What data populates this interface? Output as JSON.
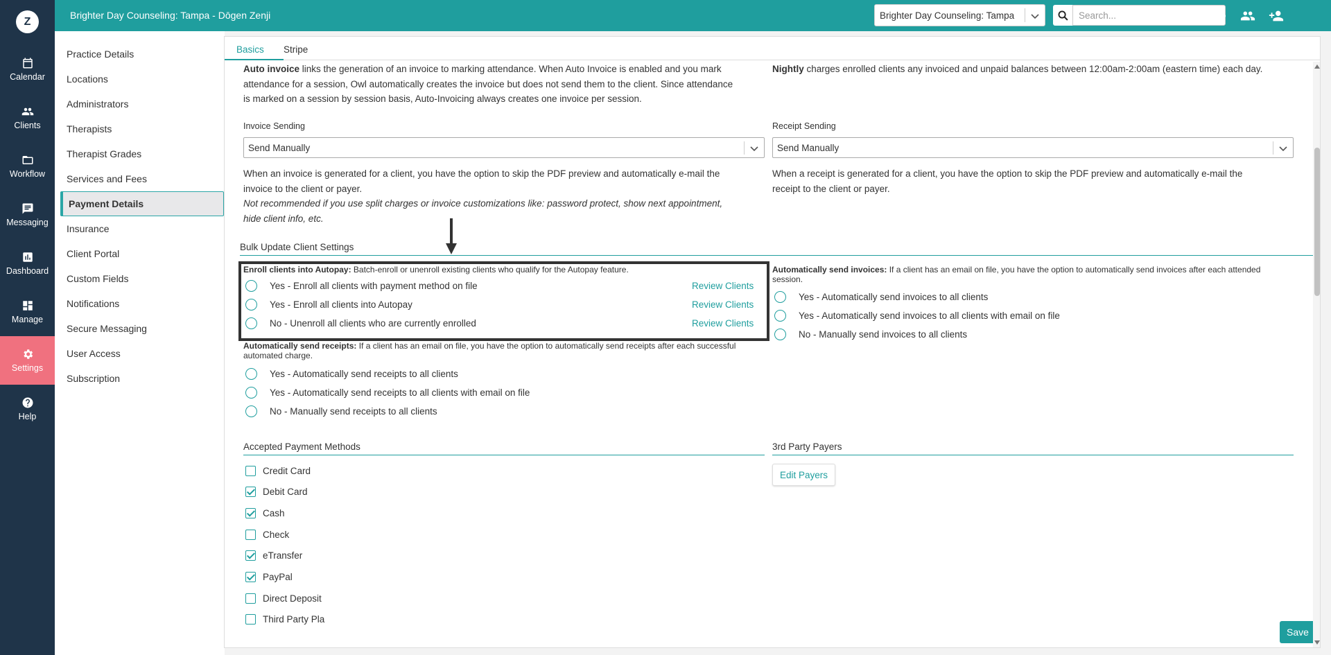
{
  "app": {
    "logo_letter": "Z",
    "header_title": "Brighter Day Counseling: Tampa - Dōgen Zenji",
    "practice_select_value": "Brighter Day Counseling: Tampa",
    "search_placeholder": "Search..."
  },
  "leftnav": {
    "items": [
      {
        "label": "Calendar",
        "icon": "calendar-icon"
      },
      {
        "label": "Clients",
        "icon": "people-icon"
      },
      {
        "label": "Workflow",
        "icon": "folder-icon"
      },
      {
        "label": "Messaging",
        "icon": "message-icon"
      },
      {
        "label": "Dashboard",
        "icon": "chart-icon"
      },
      {
        "label": "Manage",
        "icon": "grid-icon"
      },
      {
        "label": "Settings",
        "icon": "gear-icon"
      },
      {
        "label": "Help",
        "icon": "help-icon"
      }
    ]
  },
  "sidebar": {
    "items": [
      "Practice Details",
      "Locations",
      "Administrators",
      "Therapists",
      "Therapist Grades",
      "Services and Fees",
      "Payment Details",
      "Insurance",
      "Client Portal",
      "Custom Fields",
      "Notifications",
      "Secure Messaging",
      "User Access",
      "Subscription"
    ],
    "active": "Payment Details"
  },
  "tabs": [
    "Basics",
    "Stripe"
  ],
  "auto_invoice": {
    "bold": "Auto invoice",
    "line1": " links the generation of an invoice to marking attendance. When Auto Invoice is enabled and you mark",
    "line2": "attendance for a session, Owl automatically creates the invoice but does not send them to the client. Since attendance",
    "line3": "is marked on a session by session basis, Auto-Invoicing always creates one invoice per session."
  },
  "nightly": {
    "bold": "Nightly",
    "text": " charges enrolled clients any invoiced and unpaid balances between 12:00am-2:00am (eastern time) each day."
  },
  "invoice_sending": {
    "label": "Invoice Sending",
    "value": "Send Manually",
    "desc1": "When an invoice is generated for a client, you have the option to skip the PDF preview and automatically e-mail the",
    "desc2": "invoice to the client or payer.",
    "note1": "Not recommended if you use split charges or invoice customizations like: password protect, show next appointment,",
    "note2": "hide client info, etc."
  },
  "receipt_sending": {
    "label": "Receipt Sending",
    "value": "Send Manually",
    "desc1": "When a receipt is generated for a client, you have the option to skip the PDF preview and automatically e-mail the",
    "desc2": "receipt to the client or payer."
  },
  "bulk": {
    "heading": "Bulk Update Client Settings",
    "autopay_bold": "Enroll clients into Autopay:",
    "autopay_text": " Batch-enroll or unenroll existing clients who qualify for the Autopay feature.",
    "autopay_options": [
      "Yes - Enroll all clients with payment method on file",
      "Yes - Enroll all clients into Autopay",
      "No - Unenroll all clients who are currently enrolled"
    ],
    "review_label": "Review Clients",
    "receipts_bold": "Automatically send receipts:",
    "receipts_text1": " If a client has an email on file, you have the option to automatically send receipts after each successful",
    "receipts_text2": "automated charge.",
    "receipts_options": [
      "Yes - Automatically send receipts to all clients",
      "Yes - Automatically send receipts to all clients with email on file",
      "No - Manually send receipts to all clients"
    ],
    "invoices_bold": "Automatically send invoices:",
    "invoices_text1": " If a client has an email on file, you have the option to automatically send invoices after each attended",
    "invoices_text2": "session.",
    "invoices_options": [
      "Yes - Automatically send invoices to all clients",
      "Yes - Automatically send invoices to all clients with email on file",
      "No - Manually send invoices to all clients"
    ]
  },
  "payment_methods": {
    "heading": "Accepted Payment Methods",
    "items": [
      {
        "label": "Credit Card",
        "checked": false
      },
      {
        "label": "Debit Card",
        "checked": true
      },
      {
        "label": "Cash",
        "checked": true
      },
      {
        "label": "Check",
        "checked": false
      },
      {
        "label": "eTransfer",
        "checked": true
      },
      {
        "label": "PayPal",
        "checked": true
      },
      {
        "label": "Direct Deposit",
        "checked": false
      },
      {
        "label": "Third Party Pla",
        "checked": false
      }
    ]
  },
  "third_party": {
    "heading": "3rd Party Payers",
    "button": "Edit Payers"
  },
  "save_label": "Save"
}
